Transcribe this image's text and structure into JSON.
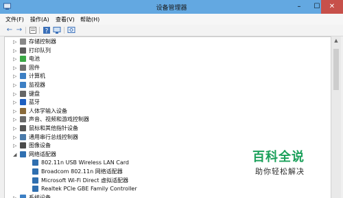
{
  "window": {
    "title": "设备管理器"
  },
  "titlebar": {
    "min": "–",
    "max": "☐",
    "close": "✕"
  },
  "menubar": {
    "items": [
      "文件(F)",
      "操作(A)",
      "查看(V)",
      "帮助(H)"
    ]
  },
  "toolbar": {
    "back": "←",
    "forward": "→",
    "icons": [
      "properties-icon",
      "help-icon",
      "monitor-icon"
    ]
  },
  "tree": {
    "items": [
      {
        "label": "存储控制器",
        "icon": "storage-controller-icon",
        "expander": "▷",
        "color": "#888888"
      },
      {
        "label": "打印队列",
        "icon": "printer-icon",
        "expander": "▷",
        "color": "#5b5b5b"
      },
      {
        "label": "电池",
        "icon": "battery-icon",
        "expander": "▷",
        "color": "#3aa845"
      },
      {
        "label": "固件",
        "icon": "firmware-icon",
        "expander": "▷",
        "color": "#707070"
      },
      {
        "label": "计算机",
        "icon": "computer-icon",
        "expander": "▷",
        "color": "#3c7fc4"
      },
      {
        "label": "监视器",
        "icon": "monitor-icon",
        "expander": "▷",
        "color": "#3c7fc4"
      },
      {
        "label": "键盘",
        "icon": "keyboard-icon",
        "expander": "▷",
        "color": "#666666"
      },
      {
        "label": "蓝牙",
        "icon": "bluetooth-icon",
        "expander": "▷",
        "color": "#1e5fc0"
      },
      {
        "label": "人体学输入设备",
        "icon": "hid-icon",
        "expander": "▷",
        "color": "#8a6a3a"
      },
      {
        "label": "声音、视频和游戏控制器",
        "icon": "sound-icon",
        "expander": "▷",
        "color": "#6a6a6a"
      },
      {
        "label": "鼠标和其他指针设备",
        "icon": "mouse-icon",
        "expander": "▷",
        "color": "#555555"
      },
      {
        "label": "通用串行总线控制器",
        "icon": "usb-icon",
        "expander": "▷",
        "color": "#4a7aaa"
      },
      {
        "label": "图像设备",
        "icon": "camera-icon",
        "expander": "▷",
        "color": "#4a4a4a"
      },
      {
        "label": "网络适配器",
        "icon": "network-adapter-icon",
        "expander": "◢",
        "color": "#2f6fb0"
      },
      {
        "label": "802.11n USB Wireless LAN Card",
        "icon": "network-card-icon",
        "expander": "",
        "color": "#2f6fb0"
      },
      {
        "label": "Broadcom 802.11n 网络适配器",
        "icon": "network-card-icon",
        "expander": "",
        "color": "#2f6fb0"
      },
      {
        "label": "Microsoft Wi-Fi Direct 虚拟适配器",
        "icon": "network-card-icon",
        "expander": "",
        "color": "#2f6fb0"
      },
      {
        "label": "Realtek PCIe GBE Family Controller",
        "icon": "network-card-icon",
        "expander": "",
        "color": "#2f6fb0"
      },
      {
        "label": "系统设备",
        "icon": "system-device-icon",
        "expander": "▷",
        "color": "#3c7fc4"
      }
    ]
  },
  "watermark": {
    "brand": "百科全说",
    "tagline": "助你轻松解决"
  },
  "colors": {
    "titlebar": "#63a8e1",
    "close": "#c7504a",
    "brand": "#1aa05a"
  }
}
